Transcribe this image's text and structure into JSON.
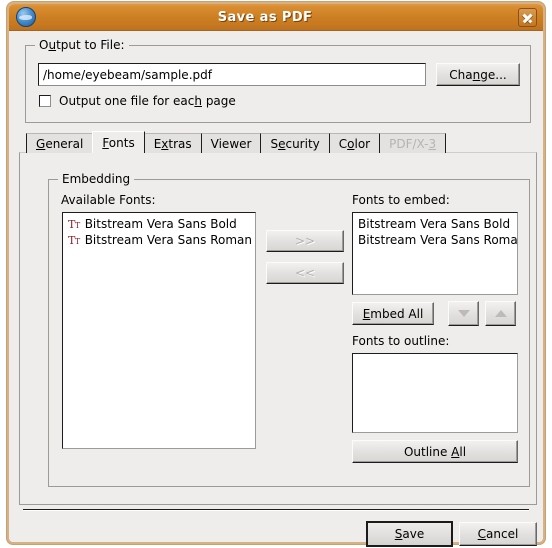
{
  "window": {
    "title": "Save as PDF",
    "icon": "globe-icon",
    "close_label": "x",
    "titlebar_color": "#cd7f24",
    "bg_color": "#efedeb"
  },
  "output_group": {
    "legend_pre": "O",
    "legend_mnemonic": "u",
    "legend_post": "tput to File:",
    "path_value": "/home/eyebeam/sample.pdf",
    "path_placeholder": "",
    "change_pre": "Cha",
    "change_mnemonic": "n",
    "change_post": "ge...",
    "checkbox_pre": "Output one file for eac",
    "checkbox_mnemonic": "h",
    "checkbox_post": " page",
    "checkbox_checked": false
  },
  "tabs": [
    {
      "pre": "",
      "mnemonic": "G",
      "post": "eneral",
      "active": false,
      "disabled": false
    },
    {
      "pre": "",
      "mnemonic": "F",
      "post": "onts",
      "active": true,
      "disabled": false
    },
    {
      "pre": "E",
      "mnemonic": "x",
      "post": "tras",
      "active": false,
      "disabled": false
    },
    {
      "pre": "Viewer",
      "mnemonic": "",
      "post": "",
      "active": false,
      "disabled": false
    },
    {
      "pre": "S",
      "mnemonic": "e",
      "post": "curity",
      "active": false,
      "disabled": false
    },
    {
      "pre": "C",
      "mnemonic": "o",
      "post": "lor",
      "active": false,
      "disabled": false
    },
    {
      "pre": "PDF/X-",
      "mnemonic": "3",
      "post": "",
      "active": false,
      "disabled": true
    }
  ],
  "embedding": {
    "legend": "Embedding",
    "available_label": "Available Fonts:",
    "available_fonts": [
      {
        "icon": "truetype-icon",
        "name": "Bitstream Vera Sans Bold"
      },
      {
        "icon": "truetype-icon",
        "name": "Bitstream Vera Sans Roman"
      }
    ],
    "move_right_label": ">>",
    "move_left_label": "<<",
    "move_right_disabled": true,
    "move_left_disabled": true,
    "embed_label": "Fonts to embed:",
    "embed_fonts": [
      {
        "name": "Bitstream Vera Sans Bold"
      },
      {
        "name": "Bitstream Vera Sans Roman"
      }
    ],
    "embed_all_pre": "",
    "embed_all_mnemonic": "E",
    "embed_all_post": "mbed All",
    "move_down_label": "down-arrow-icon",
    "move_up_label": "up-arrow-icon",
    "move_down_disabled": true,
    "move_up_disabled": true,
    "outline_label": "Fonts to outline:",
    "outline_fonts": [],
    "outline_all_pre": "Outline ",
    "outline_all_mnemonic": "A",
    "outline_all_post": "ll"
  },
  "footer": {
    "save_pre": "",
    "save_mnemonic": "S",
    "save_post": "ave",
    "cancel_pre": "",
    "cancel_mnemonic": "C",
    "cancel_post": "ancel"
  }
}
